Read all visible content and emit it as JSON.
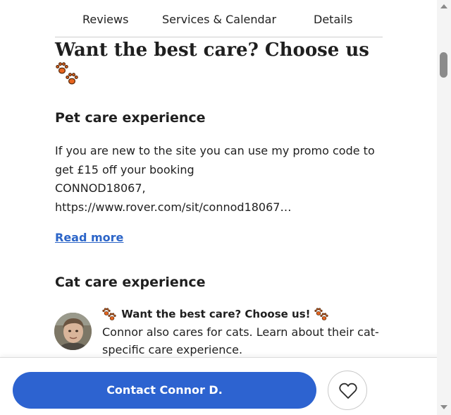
{
  "tabs": [
    {
      "label": "Reviews"
    },
    {
      "label": "Services & Calendar"
    },
    {
      "label": "Details"
    }
  ],
  "headline": "Want the best care? Choose us",
  "pet_care": {
    "title": "Pet care experience",
    "lines": [
      "If you are new to the site you can use my promo code to",
      "get £15 off your booking",
      "CONNOD18067,",
      "https://www.rover.com/sit/connod18067…"
    ],
    "read_more": "Read more"
  },
  "cat_care": {
    "title": "Cat care experience",
    "heading": "Want the best care? Choose us!",
    "lines": [
      "Connor also cares for cats. Learn about their cat-",
      "specific care experience."
    ]
  },
  "footer": {
    "contact_label": "Contact Connor D."
  },
  "icons": {
    "paw": "paw-prints-icon",
    "favorite": "heart-icon",
    "avatar": "profile-photo"
  },
  "colors": {
    "accent": "#2d63d0",
    "link": "#2c65c8",
    "paw": "#e8651f"
  }
}
